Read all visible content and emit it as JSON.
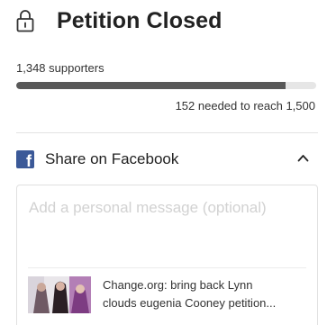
{
  "petition": {
    "title": "Petition Closed",
    "supporters_text": "1,348 supporters",
    "progress_fraction": 0.899,
    "needed_text": "152 needed to reach 1,500"
  },
  "share": {
    "facebook_label": "Share on Facebook",
    "message_placeholder": "Add a personal message (optional)",
    "message_value": "",
    "preview_line1": "Change.org: bring back Lynn",
    "preview_line2": "clouds eugenia Cooney petition..."
  },
  "icons": {
    "lock": "lock-icon",
    "facebook": "facebook-icon",
    "chevron": "chevron-up-icon",
    "thumbnail": "petition-thumbnail"
  },
  "colors": {
    "progress_fill": "#595959",
    "progress_track": "#e6e6e6",
    "facebook_blue": "#3b5998"
  }
}
